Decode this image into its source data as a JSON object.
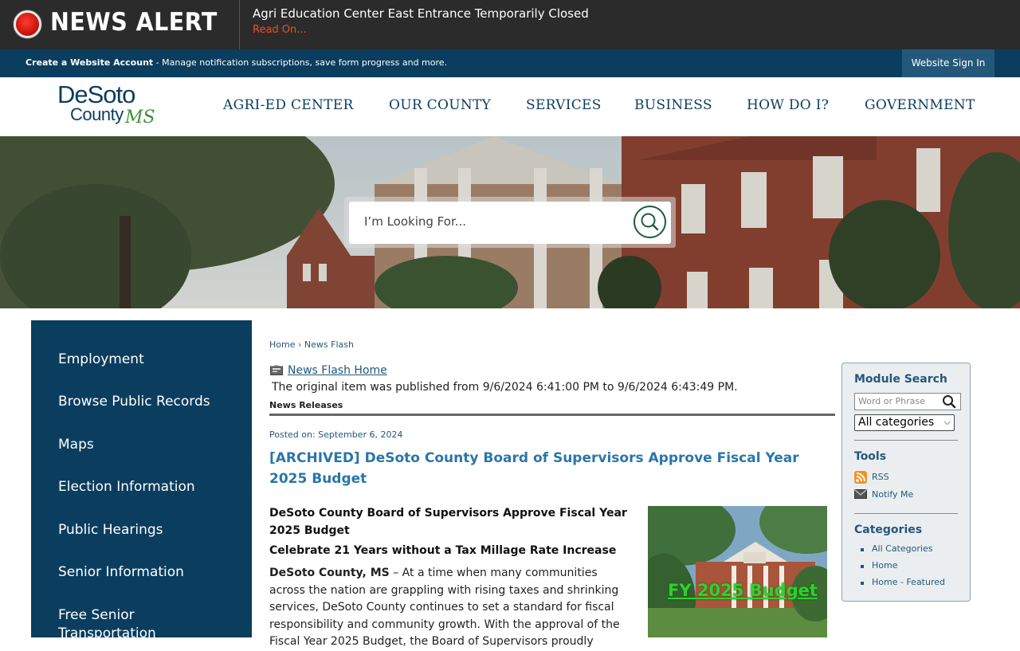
{
  "alert": {
    "title": "NEWS ALERT",
    "headline": "Agri Education Center East Entrance Temporarily Closed",
    "link": "Read On..."
  },
  "account_bar": {
    "create_label": "Create a Website Account",
    "create_desc": " - Manage notification subscriptions, save form progress and more.",
    "signin_label": "Website Sign In"
  },
  "logo": {
    "line1": "DeSoto",
    "line2": "County",
    "line3": "MS"
  },
  "nav": {
    "items": [
      "AGRI-ED CENTER",
      "OUR COUNTY",
      "SERVICES",
      "BUSINESS",
      "HOW DO I?",
      "GOVERNMENT"
    ]
  },
  "hero": {
    "search_placeholder": "I’m Looking For..."
  },
  "sidebar": {
    "items": [
      "Employment",
      "Browse Public Records",
      "Maps",
      "Election Information",
      "Public Hearings",
      "Senior Information",
      "Free Senior",
      "Transportation"
    ]
  },
  "breadcrumb": {
    "home": "Home",
    "sep": "›",
    "current": "News Flash"
  },
  "newsflash": {
    "home_link": "News Flash Home",
    "original": "The original item was published from 9/6/2024 6:41:00 PM to 9/6/2024 6:43:49 PM.",
    "category": "News Releases"
  },
  "article": {
    "posted": "Posted on: September 6, 2024",
    "title": "[ARCHIVED] DeSoto County Board of Supervisors Approve Fiscal Year 2025 Budget",
    "heading": "DeSoto County Board of Supervisors Approve Fiscal Year 2025 Budget",
    "subheading": "Celebrate 21 Years without a Tax Millage Rate Increase",
    "dateline": "DeSoto County, MS",
    "body": " – At a time when many communities across the nation are grappling with rising taxes and shrinking services, DeSoto County continues to set a standard for fiscal responsibility and community growth. With the approval of the Fiscal Year 2025 Budget, the Board of Supervisors proudly",
    "image_caption": "FY 2025 Budget"
  },
  "panel": {
    "module_search": "Module Search",
    "search_placeholder": "Word or Phrase",
    "select_value": "All categories",
    "tools": "Tools",
    "rss": "RSS",
    "notify": "Notify Me",
    "categories": "Categories",
    "category_links": [
      "All Categories",
      "Home",
      "Home - Featured"
    ]
  },
  "colors": {
    "alert_bg": "#2b2b2b",
    "brand_navy": "#0b3d5e",
    "link_blue": "#24587a",
    "title_blue": "#2a76a8",
    "alert_link": "#e8502a"
  }
}
